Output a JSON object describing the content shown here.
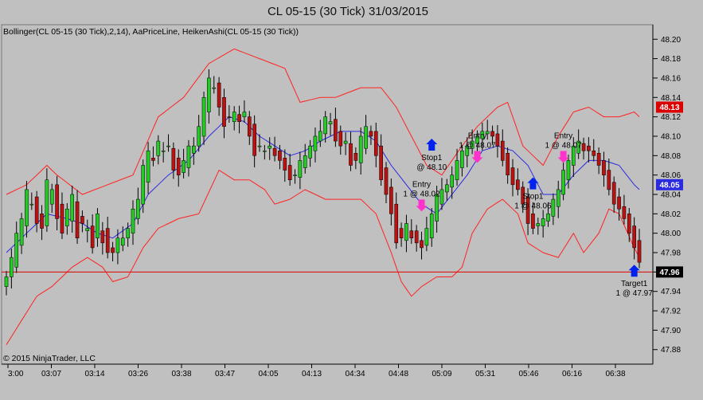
{
  "title": "CL 05-15 (30 Tick)  31/03/2015",
  "legend": "Bollinger(CL 05-15 (30 Tick),2,14), AaPriceLine, HeikenAshi(CL 05-15 (30 Tick))",
  "copyright": "© 2015 NinjaTrader, LLC",
  "colors": {
    "background": "#c0c0c0",
    "up_candle": "#22cc22",
    "down_candle": "#bb1111",
    "bollinger_bands": "#ff2222",
    "bollinger_mid": "#2a2ae0",
    "price_line": "#dd0000",
    "entry_arrow": "#ff33cc",
    "exit_arrow": "#0022ee"
  },
  "chart_data": {
    "type": "candlestick",
    "xlabel": "",
    "ylabel": "",
    "ylim": [
      47.865,
      48.215
    ],
    "x_ticks": [
      "3:00",
      "03:07",
      "03:14",
      "03:26",
      "03:38",
      "03:47",
      "04:05",
      "04:13",
      "04:34",
      "04:48",
      "05:09",
      "05:31",
      "05:46",
      "06:16",
      "06:38"
    ],
    "y_ticks": [
      47.88,
      47.9,
      47.92,
      47.94,
      47.96,
      47.98,
      48.0,
      48.02,
      48.04,
      48.06,
      48.08,
      48.1,
      48.12,
      48.14,
      48.16,
      48.18,
      48.2
    ],
    "closes": [
      47.955,
      47.975,
      48.0,
      48.015,
      48.045,
      48.03,
      48.01,
      48.005,
      48.055,
      48.045,
      48.015,
      48.0,
      48.025,
      48.04,
      47.995,
      48.01,
      48.005,
      47.985,
      48.02,
      47.99,
      47.98,
      47.98,
      47.995,
      47.995,
      48.005,
      48.025,
      48.035,
      48.07,
      48.085,
      48.075,
      48.095,
      48.085,
      48.09,
      48.065,
      48.06,
      48.075,
      48.09,
      48.09,
      48.11,
      48.14,
      48.16,
      48.15,
      48.13,
      48.11,
      48.12,
      48.125,
      48.115,
      48.125,
      48.1,
      48.08,
      48.09,
      48.085,
      48.09,
      48.08,
      48.075,
      48.065,
      48.055,
      48.06,
      48.075,
      48.08,
      48.09,
      48.1,
      48.105,
      48.12,
      48.115,
      48.095,
      48.09,
      48.095,
      48.07,
      48.075,
      48.1,
      48.11,
      48.1,
      48.08,
      48.055,
      48.04,
      48.02,
      47.99,
      47.995,
      48.01,
      47.995,
      47.99,
      47.985,
      48.005,
      48.02,
      48.04,
      48.045,
      48.05,
      48.06,
      48.075,
      48.085,
      48.09,
      48.095,
      48.1,
      48.105,
      48.105,
      48.1,
      48.09,
      48.075,
      48.06,
      48.05,
      48.045,
      48.03,
      48.01,
      48.005,
      48.01,
      48.015,
      48.02,
      48.035,
      48.045,
      48.065,
      48.075,
      48.09,
      48.095,
      48.085,
      48.085,
      48.08,
      48.07,
      48.06,
      48.045,
      48.03,
      48.025,
      48.015,
      48.0,
      47.985,
      47.97
    ],
    "bollinger": {
      "period": 14,
      "std_dev": 2,
      "upper_anchors": [
        [
          0,
          48.04
        ],
        [
          4,
          48.05
        ],
        [
          8,
          48.07
        ],
        [
          10,
          48.06
        ],
        [
          15,
          48.04
        ],
        [
          20,
          48.05
        ],
        [
          25,
          48.06
        ],
        [
          30,
          48.12
        ],
        [
          35,
          48.14
        ],
        [
          40,
          48.175
        ],
        [
          45,
          48.19
        ],
        [
          50,
          48.18
        ],
        [
          55,
          48.17
        ],
        [
          58,
          48.135
        ],
        [
          62,
          48.14
        ],
        [
          65,
          48.14
        ],
        [
          70,
          48.15
        ],
        [
          74,
          48.15
        ],
        [
          77,
          48.13
        ],
        [
          80,
          48.1
        ],
        [
          83,
          48.07
        ],
        [
          86,
          48.06
        ],
        [
          90,
          48.09
        ],
        [
          93,
          48.11
        ],
        [
          97,
          48.13
        ],
        [
          99,
          48.135
        ],
        [
          102,
          48.09
        ],
        [
          104,
          48.08
        ],
        [
          106,
          48.07
        ],
        [
          109,
          48.1
        ],
        [
          112,
          48.125
        ],
        [
          115,
          48.13
        ],
        [
          118,
          48.12
        ],
        [
          121,
          48.12
        ],
        [
          124,
          48.125
        ],
        [
          125,
          48.12
        ]
      ],
      "middle_anchors": [
        [
          0,
          47.98
        ],
        [
          4,
          48.0
        ],
        [
          8,
          48.02
        ],
        [
          12,
          48.015
        ],
        [
          15,
          48.01
        ],
        [
          18,
          48.0
        ],
        [
          21,
          47.995
        ],
        [
          25,
          48.01
        ],
        [
          28,
          48.04
        ],
        [
          32,
          48.06
        ],
        [
          36,
          48.075
        ],
        [
          40,
          48.1
        ],
        [
          44,
          48.12
        ],
        [
          47,
          48.115
        ],
        [
          50,
          48.1
        ],
        [
          53,
          48.09
        ],
        [
          56,
          48.08
        ],
        [
          59,
          48.085
        ],
        [
          62,
          48.095
        ],
        [
          66,
          48.105
        ],
        [
          70,
          48.105
        ],
        [
          73,
          48.095
        ],
        [
          76,
          48.07
        ],
        [
          79,
          48.05
        ],
        [
          82,
          48.03
        ],
        [
          85,
          48.02
        ],
        [
          88,
          48.04
        ],
        [
          91,
          48.06
        ],
        [
          94,
          48.085
        ],
        [
          97,
          48.09
        ],
        [
          100,
          48.085
        ],
        [
          103,
          48.07
        ],
        [
          106,
          48.04
        ],
        [
          109,
          48.04
        ],
        [
          112,
          48.06
        ],
        [
          115,
          48.075
        ],
        [
          118,
          48.075
        ],
        [
          121,
          48.07
        ],
        [
          124,
          48.05
        ],
        [
          125,
          48.045
        ]
      ],
      "lower_anchors": [
        [
          0,
          47.885
        ],
        [
          3,
          47.91
        ],
        [
          6,
          47.935
        ],
        [
          9,
          47.945
        ],
        [
          13,
          47.965
        ],
        [
          16,
          47.975
        ],
        [
          19,
          47.965
        ],
        [
          21,
          47.95
        ],
        [
          24,
          47.955
        ],
        [
          27,
          47.985
        ],
        [
          30,
          48.005
        ],
        [
          34,
          48.015
        ],
        [
          38,
          48.02
        ],
        [
          42,
          48.065
        ],
        [
          45,
          48.055
        ],
        [
          48,
          48.055
        ],
        [
          51,
          48.045
        ],
        [
          53,
          48.03
        ],
        [
          56,
          48.035
        ],
        [
          59,
          48.045
        ],
        [
          63,
          48.035
        ],
        [
          67,
          48.035
        ],
        [
          70,
          48.035
        ],
        [
          73,
          48.02
        ],
        [
          76,
          47.98
        ],
        [
          78,
          47.95
        ],
        [
          80,
          47.935
        ],
        [
          82,
          47.945
        ],
        [
          85,
          47.955
        ],
        [
          88,
          47.955
        ],
        [
          90,
          47.965
        ],
        [
          92,
          48.0
        ],
        [
          95,
          48.025
        ],
        [
          98,
          48.035
        ],
        [
          101,
          48.02
        ],
        [
          103,
          47.99
        ],
        [
          106,
          47.98
        ],
        [
          109,
          47.975
        ],
        [
          112,
          48.0
        ],
        [
          114,
          47.98
        ],
        [
          117,
          48.0
        ],
        [
          119,
          48.025
        ],
        [
          121,
          48.02
        ],
        [
          124,
          47.985
        ],
        [
          125,
          47.975
        ]
      ]
    },
    "price_line": 47.96,
    "current_price_label": "48.13",
    "price_line_label": "47.96",
    "midband_label": "48.05",
    "annotations": [
      {
        "label": "Entry",
        "sub": "1 @ 48.02",
        "bar": 82,
        "price": 48.02,
        "kind": "entry"
      },
      {
        "label": "Stop1",
        "sub": "@ 48.10",
        "bar": 84,
        "price": 48.1,
        "kind": "exit"
      },
      {
        "label": "Entry",
        "sub": "1 @ 48.07",
        "bar": 93,
        "price": 48.07,
        "kind": "entry"
      },
      {
        "label": "Stop1",
        "sub": "1 @ 48.06",
        "bar": 104,
        "price": 48.06,
        "kind": "exit"
      },
      {
        "label": "Entry",
        "sub": "1 @ 48.07",
        "bar": 110,
        "price": 48.07,
        "kind": "entry"
      },
      {
        "label": "Target1",
        "sub": "1 @ 47.97",
        "bar": 124,
        "price": 47.97,
        "kind": "exit"
      }
    ]
  }
}
